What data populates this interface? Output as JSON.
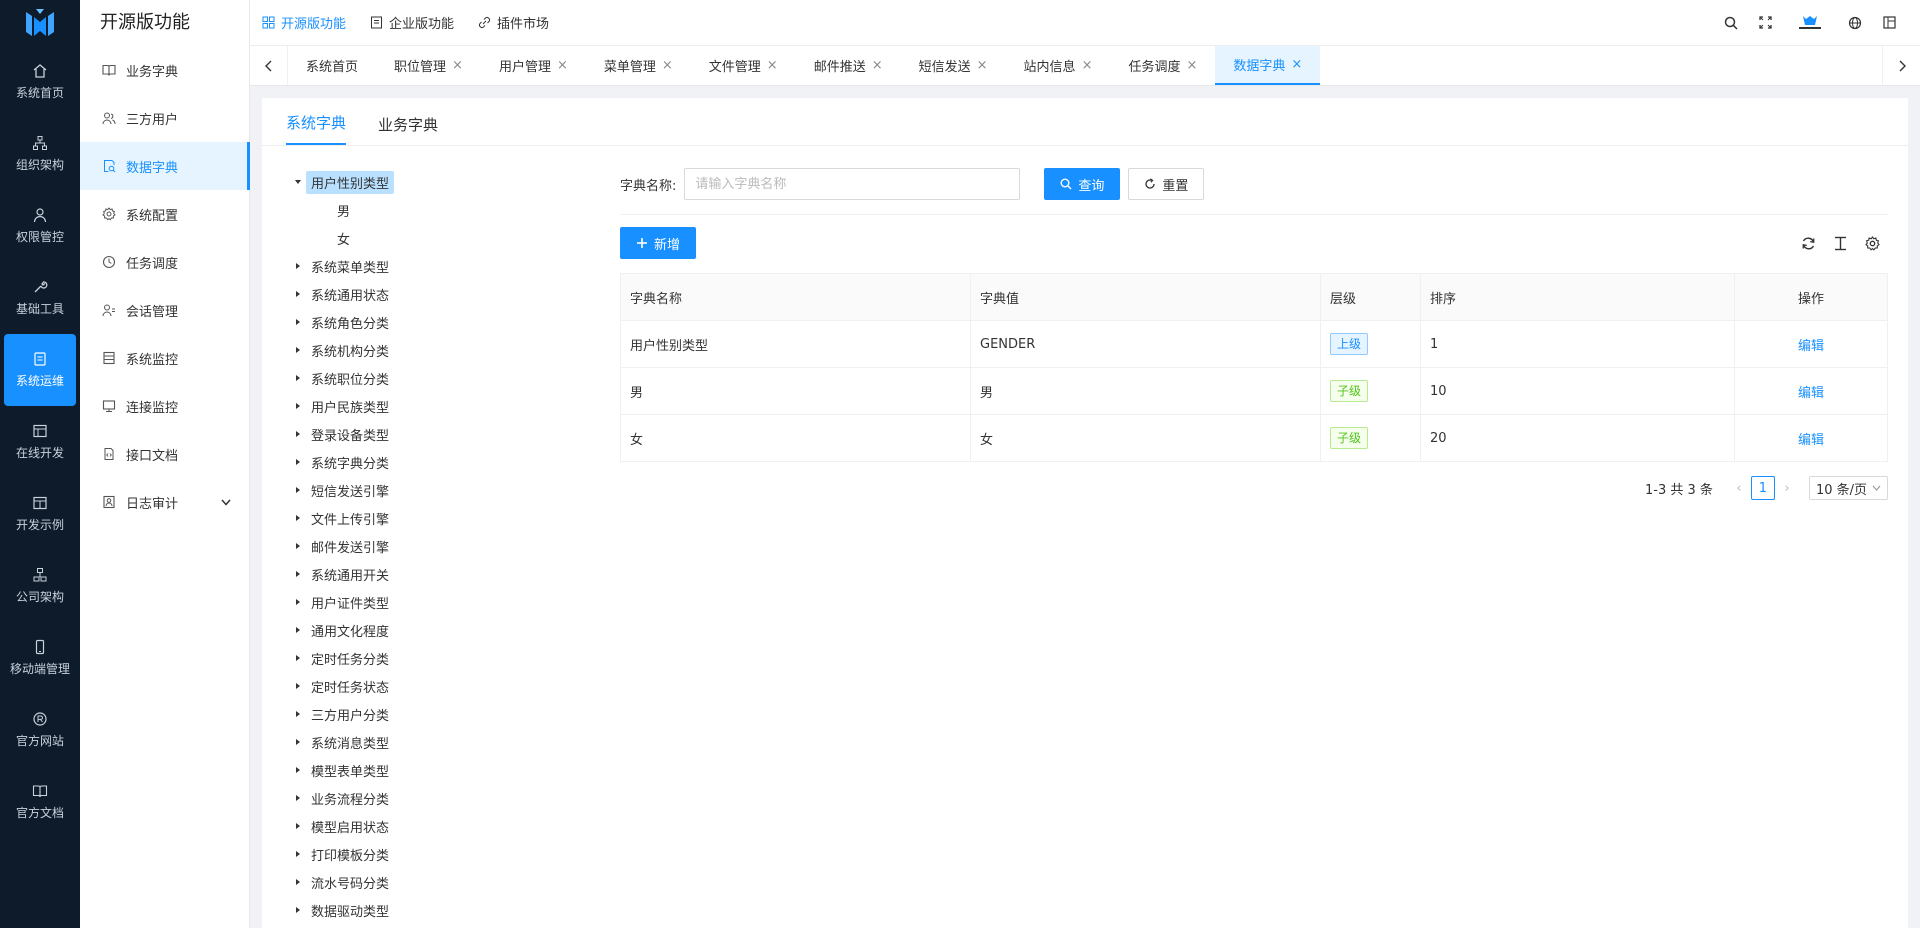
{
  "rail": {
    "items": [
      {
        "label": "系统首页",
        "icon": "home-icon"
      },
      {
        "label": "组织架构",
        "icon": "org-icon"
      },
      {
        "label": "权限管控",
        "icon": "user-icon"
      },
      {
        "label": "基础工具",
        "icon": "tool-icon"
      },
      {
        "label": "系统运维",
        "icon": "ops-icon"
      },
      {
        "label": "在线开发",
        "icon": "dev-icon"
      },
      {
        "label": "开发示例",
        "icon": "example-icon"
      },
      {
        "label": "公司架构",
        "icon": "company-icon"
      },
      {
        "label": "移动端管理",
        "icon": "mobile-icon"
      },
      {
        "label": "官方网站",
        "icon": "website-icon"
      },
      {
        "label": "官方文档",
        "icon": "docs-icon"
      }
    ],
    "active_index": 4
  },
  "sidebar": {
    "title": "开源版功能",
    "items": [
      {
        "label": "业务字典"
      },
      {
        "label": "三方用户"
      },
      {
        "label": "数据字典"
      },
      {
        "label": "系统配置"
      },
      {
        "label": "任务调度"
      },
      {
        "label": "会话管理"
      },
      {
        "label": "系统监控"
      },
      {
        "label": "连接监控"
      },
      {
        "label": "接口文档"
      },
      {
        "label": "日志审计"
      }
    ],
    "active_index": 2
  },
  "header": {
    "nav": [
      {
        "label": "开源版功能"
      },
      {
        "label": "企业版功能"
      },
      {
        "label": "插件市场"
      }
    ]
  },
  "tabs": [
    {
      "label": "系统首页"
    },
    {
      "label": "职位管理"
    },
    {
      "label": "用户管理"
    },
    {
      "label": "菜单管理"
    },
    {
      "label": "文件管理"
    },
    {
      "label": "邮件推送"
    },
    {
      "label": "短信发送"
    },
    {
      "label": "站内信息"
    },
    {
      "label": "任务调度"
    },
    {
      "label": "数据字典"
    }
  ],
  "content_tabs": [
    {
      "label": "系统字典"
    },
    {
      "label": "业务字典"
    }
  ],
  "tree": {
    "expanded": {
      "label": "用户性别类型",
      "children": [
        "男",
        "女"
      ]
    },
    "nodes": [
      "系统菜单类型",
      "系统通用状态",
      "系统角色分类",
      "系统机构分类",
      "系统职位分类",
      "用户民族类型",
      "登录设备类型",
      "系统字典分类",
      "短信发送引擎",
      "文件上传引擎",
      "邮件发送引擎",
      "系统通用开关",
      "用户证件类型",
      "通用文化程度",
      "定时任务分类",
      "定时任务状态",
      "三方用户分类",
      "系统消息类型",
      "模型表单类型",
      "业务流程分类",
      "模型启用状态",
      "打印模板分类",
      "流水号码分类",
      "数据驱动类型"
    ]
  },
  "search": {
    "label": "字典名称:",
    "placeholder": "请输入字典名称",
    "query_label": "查询",
    "reset_label": "重置",
    "add_label": "新增"
  },
  "table": {
    "columns": [
      "字典名称",
      "字典值",
      "层级",
      "排序",
      "操作"
    ],
    "rows": [
      {
        "name": "用户性别类型",
        "value": "GENDER",
        "level": "上级",
        "level_type": "parent",
        "sort": "1",
        "op": "编辑"
      },
      {
        "name": "男",
        "value": "男",
        "level": "子级",
        "level_type": "child",
        "sort": "10",
        "op": "编辑"
      },
      {
        "name": "女",
        "value": "女",
        "level": "子级",
        "level_type": "child",
        "sort": "20",
        "op": "编辑"
      }
    ]
  },
  "pager": {
    "total_text": "1-3 共 3 条",
    "current_page": "1",
    "page_size": "10 条/页"
  },
  "colors": {
    "primary": "#1890ff",
    "rail_bg": "#0d1b2a",
    "parent_tag": "#1890ff",
    "child_tag": "#52c41a"
  }
}
